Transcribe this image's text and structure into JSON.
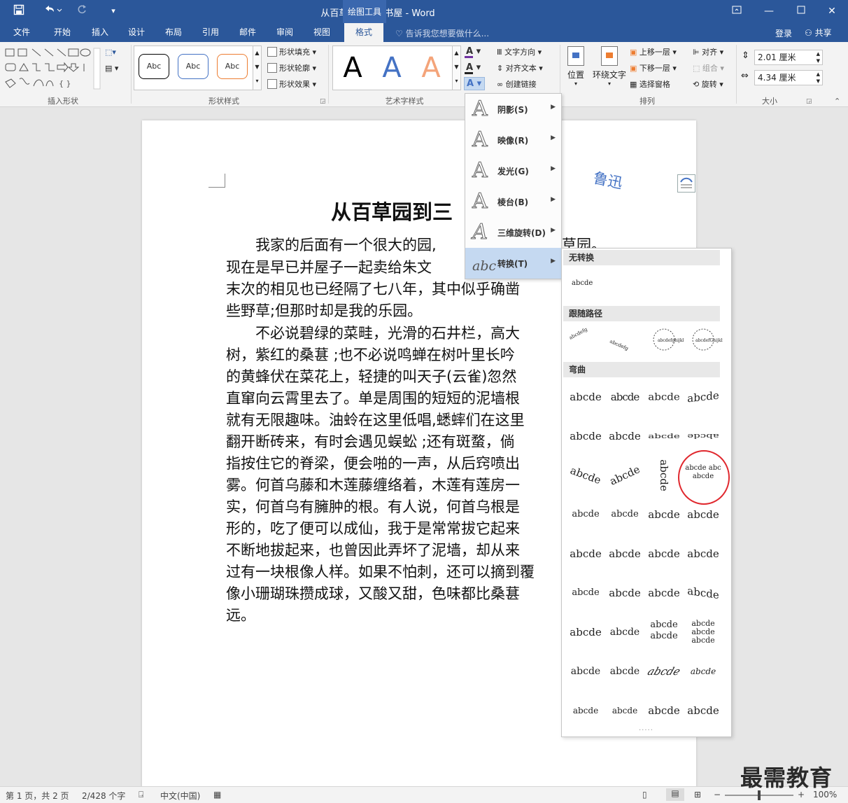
{
  "app": {
    "document_title": "从百草园到三味书屋 - Word",
    "context_group": "绘图工具"
  },
  "tabs": [
    "文件",
    "开始",
    "插入",
    "设计",
    "布局",
    "引用",
    "邮件",
    "审阅",
    "视图",
    "格式"
  ],
  "active_tab": "格式",
  "tell_me": "告诉我您想要做什么...",
  "account": {
    "signin": "登录",
    "share": "共享"
  },
  "ribbon": {
    "groups": {
      "insert_shapes": "插入形状",
      "shape_styles": "形状样式",
      "wordart_styles": "艺术字样式",
      "arrange": "排列",
      "size": "大小"
    },
    "shape_style_samples": [
      "Abc",
      "Abc",
      "Abc"
    ],
    "shape_style_colors": [
      "#000000",
      "#4472c4",
      "#ed7d31"
    ],
    "shape_buttons": [
      "形状填充",
      "形状轮廓",
      "形状效果"
    ],
    "wordart_samples": [
      "A",
      "A",
      "A"
    ],
    "wordart_colors": [
      "#000000",
      "#4472c4",
      "#f4a47a"
    ],
    "text_buttons": [
      "文字方向",
      "对齐文本",
      "创建链接"
    ],
    "arrange_big": [
      "位置",
      "环绕文字"
    ],
    "arrange_small": [
      "上移一层",
      "下移一层",
      "选择窗格",
      "对齐",
      "组合",
      "旋转"
    ],
    "size": {
      "height": "2.01 厘米",
      "width": "4.34 厘米"
    }
  },
  "document": {
    "heading": "从百草园到三",
    "lines": [
      "　　我家的后面有一个很大的园,",
      "现在是早已并屋子一起卖给朱文",
      "末次的相见也已经隔了七八年，其中似乎确凿",
      "些野草;但那时却是我的乐园。",
      "　　不必说碧绿的菜畦，光滑的石井栏，高大",
      "树，紫红的桑葚 ;也不必说鸣蝉在树叶里长吟",
      "的黄蜂伏在菜花上，轻捷的叫天子(云雀)忽然",
      "直窜向云霄里去了。单是周围的短短的泥墙根",
      "就有无限趣味。油蛉在这里低唱,蟋蟀们在这里",
      "翻开断砖来，有时会遇见蜈蚣 ;还有斑蝥，倘",
      "指按住它的脊梁，便会啪的一声，从后窍喷出",
      "雾。何首乌藤和木莲藤缠络着，木莲有莲房一",
      "实，何首乌有臃肿的根。有人说，何首乌根是",
      "形的，吃了便可以成仙，我于是常常拔它起来",
      "不断地拔起来，也曾因此弄坏了泥墙，却从来",
      "过有一块根像人样。如果不怕刺，还可以摘到覆",
      "像小珊瑚珠攒成球，又酸又甜，色味都比桑葚",
      "远。"
    ],
    "line_tail": "草园。",
    "wordart_sample": "鲁迅"
  },
  "effects_menu": [
    {
      "label": "阴影(S)"
    },
    {
      "label": "映像(R)"
    },
    {
      "label": "发光(G)"
    },
    {
      "label": "棱台(B)"
    },
    {
      "label": "三维旋转(D)"
    },
    {
      "label": "转换(T)",
      "selected": true
    }
  ],
  "transform_gallery": {
    "sections": [
      "无转换",
      "跟随路径",
      "弯曲"
    ],
    "no_transform_sample": "abcde",
    "follow_path": [
      "abcdefg",
      "abcdefg",
      "abcdefghijklmno",
      "abcdefGhijklmno"
    ],
    "warp_cells": [
      "abcde",
      "abcde",
      "abcde",
      "abcde",
      "abcde",
      "abcde",
      "abcde",
      "abcde",
      "abcde",
      "abcde",
      "abcde",
      "abcde abc abcde",
      "abcde",
      "abcde",
      "abcde",
      "abcde",
      "abcde",
      "abcde",
      "abcde",
      "abcde",
      "abcde",
      "abcde",
      "abcde",
      "abcde",
      "abcde",
      "abcde",
      "abcde abcde",
      "abcde abcde abcde",
      "abcde",
      "abcde",
      "abcde",
      "abcde",
      "abcde",
      "abcde",
      "abcde",
      "abcde"
    ],
    "highlighted_index": 11,
    "highlight_color": "#e0282e"
  },
  "status": {
    "page": "第 1 页，共 2 页",
    "words": "2/428 个字",
    "language": "中文(中国)",
    "zoom": "100%"
  },
  "watermark": "最需教育",
  "colors": {
    "brand": "#2b579a",
    "ribbon_bg": "#f3f3f3",
    "selection": "#c5d9f1"
  }
}
